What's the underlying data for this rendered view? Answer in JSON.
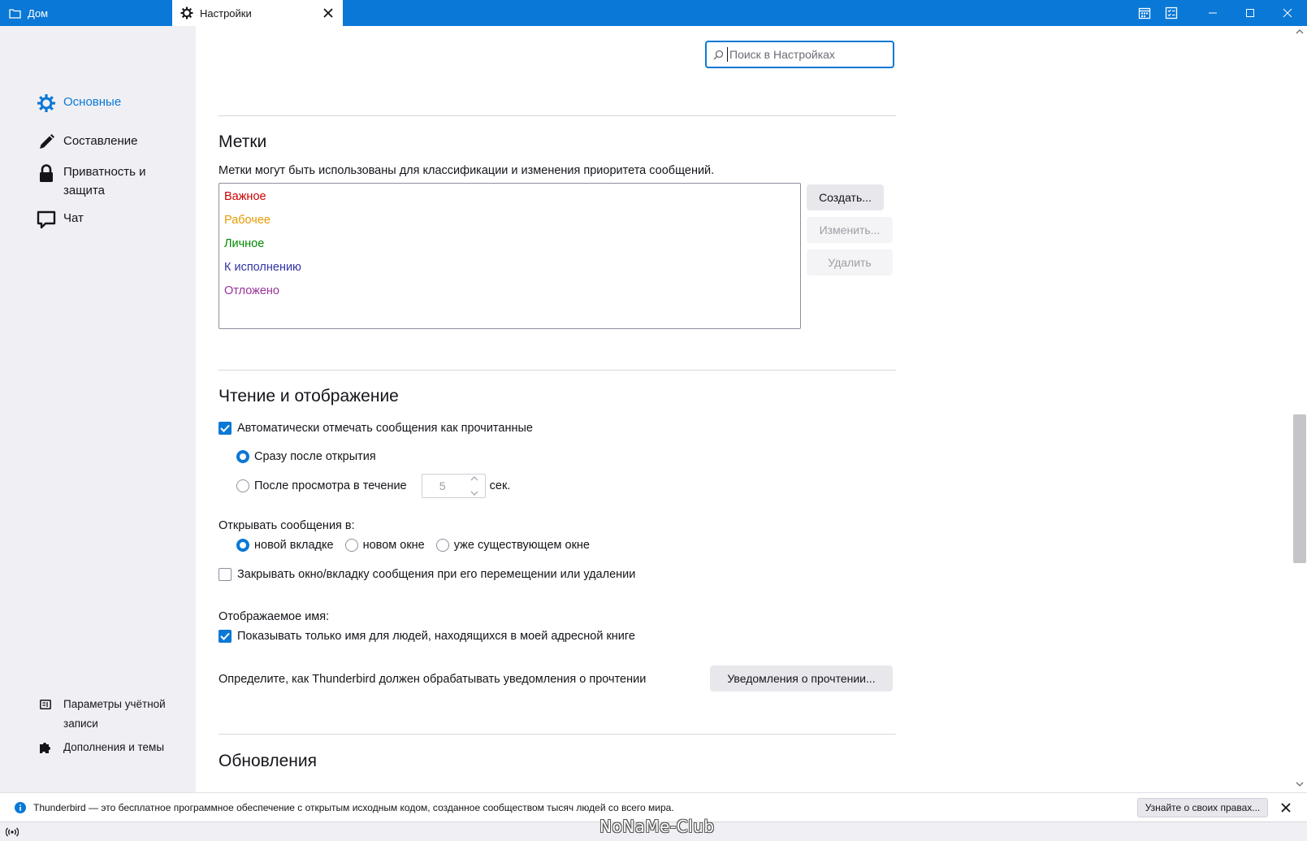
{
  "tabs": [
    {
      "label": "Дом",
      "icon": "folder-icon"
    },
    {
      "label": "Настройки",
      "icon": "gear-icon"
    }
  ],
  "search": {
    "placeholder": "Поиск в Настройках"
  },
  "sidebar": {
    "items": [
      {
        "label": "Основные",
        "icon": "gear-icon",
        "active": true
      },
      {
        "label": "Составление",
        "icon": "pencil-icon"
      },
      {
        "label": "Приватность и защита",
        "icon": "lock-icon"
      },
      {
        "label": "Чат",
        "icon": "chat-bubble-icon"
      }
    ],
    "bottom": [
      {
        "label": "Параметры учётной записи",
        "icon": "account-settings-icon"
      },
      {
        "label": "Дополнения и темы",
        "icon": "puzzle-icon"
      }
    ]
  },
  "tags_section": {
    "title": "Метки",
    "description": "Метки могут быть использованы для классификации и изменения приоритета сообщений.",
    "tags": [
      {
        "label": "Важное",
        "color": "#cc0000"
      },
      {
        "label": "Рабочее",
        "color": "#e69a00"
      },
      {
        "label": "Личное",
        "color": "#008800"
      },
      {
        "label": "К исполнению",
        "color": "#3333aa"
      },
      {
        "label": "Отложено",
        "color": "#993399"
      }
    ],
    "buttons": {
      "create": "Создать...",
      "edit": "Изменить...",
      "delete": "Удалить"
    }
  },
  "reading": {
    "title": "Чтение и отображение",
    "auto_mark": {
      "label": "Автоматически отмечать сообщения как прочитанные",
      "checked": true
    },
    "immediately": {
      "label": "Сразу после открытия",
      "selected": true
    },
    "after_delay": {
      "label": "После просмотра в течение",
      "value": "5",
      "unit": "сек."
    },
    "open_in_label": "Открывать сообщения в:",
    "open_in": [
      {
        "label": "новой вкладке",
        "selected": true
      },
      {
        "label": "новом окне",
        "selected": false
      },
      {
        "label": "уже существующем окне",
        "selected": false
      }
    ],
    "close_on_move": {
      "label": "Закрывать окно/вкладку сообщения при его перемещении или удалении",
      "checked": false
    },
    "display_name_label": "Отображаемое имя:",
    "show_name_only": {
      "label": "Показывать только имя для людей, находящихся в моей адресной книге",
      "checked": true
    },
    "receipts_text": "Определите, как Thunderbird должен обрабатывать уведомления о прочтении",
    "receipts_button": "Уведомления о прочтении..."
  },
  "updates": {
    "title": "Обновления"
  },
  "notification": {
    "text": "Thunderbird — это бесплатное программное обеспечение с открытым исходным кодом, созданное сообществом тысяч людей со всего мира.",
    "button": "Узнайте о своих правах..."
  },
  "watermark": "NoNaMe-Club",
  "colors": {
    "accent": "#0a78d6",
    "titlebar": "#0a78d6",
    "sidebar": "#f0f0f4"
  }
}
